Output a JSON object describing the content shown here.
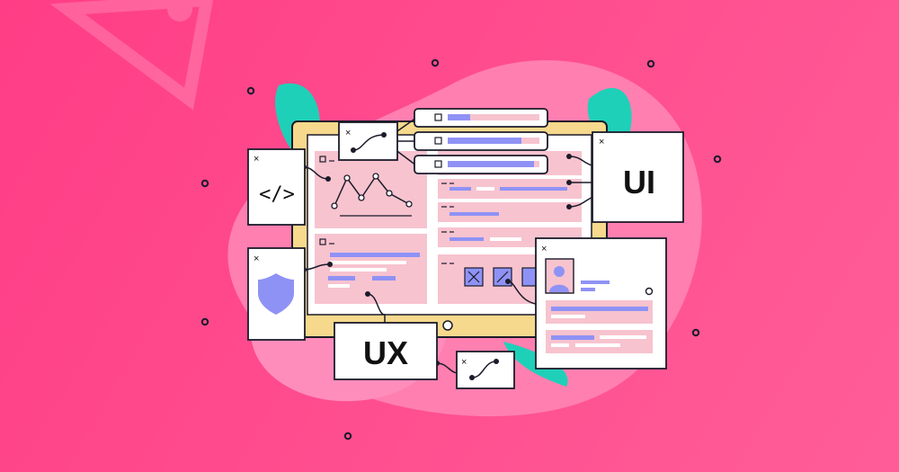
{
  "labels": {
    "ui": "UI",
    "ux": "UX",
    "code": "</>",
    "close": "×"
  },
  "colors": {
    "background": "#ff4c8e",
    "blob": "#ff7fb0",
    "teal": "#1fd0b8",
    "panel": "#ffffff",
    "pink_block": "#f7c3cf",
    "lavender": "#8f92f5",
    "tablet_frame": "#f6d98c",
    "outline": "#1b1b2a"
  },
  "icons": [
    "close-icon",
    "line-chart-icon",
    "shield-icon",
    "avatar-icon",
    "code-icon",
    "checkbox-icon"
  ]
}
